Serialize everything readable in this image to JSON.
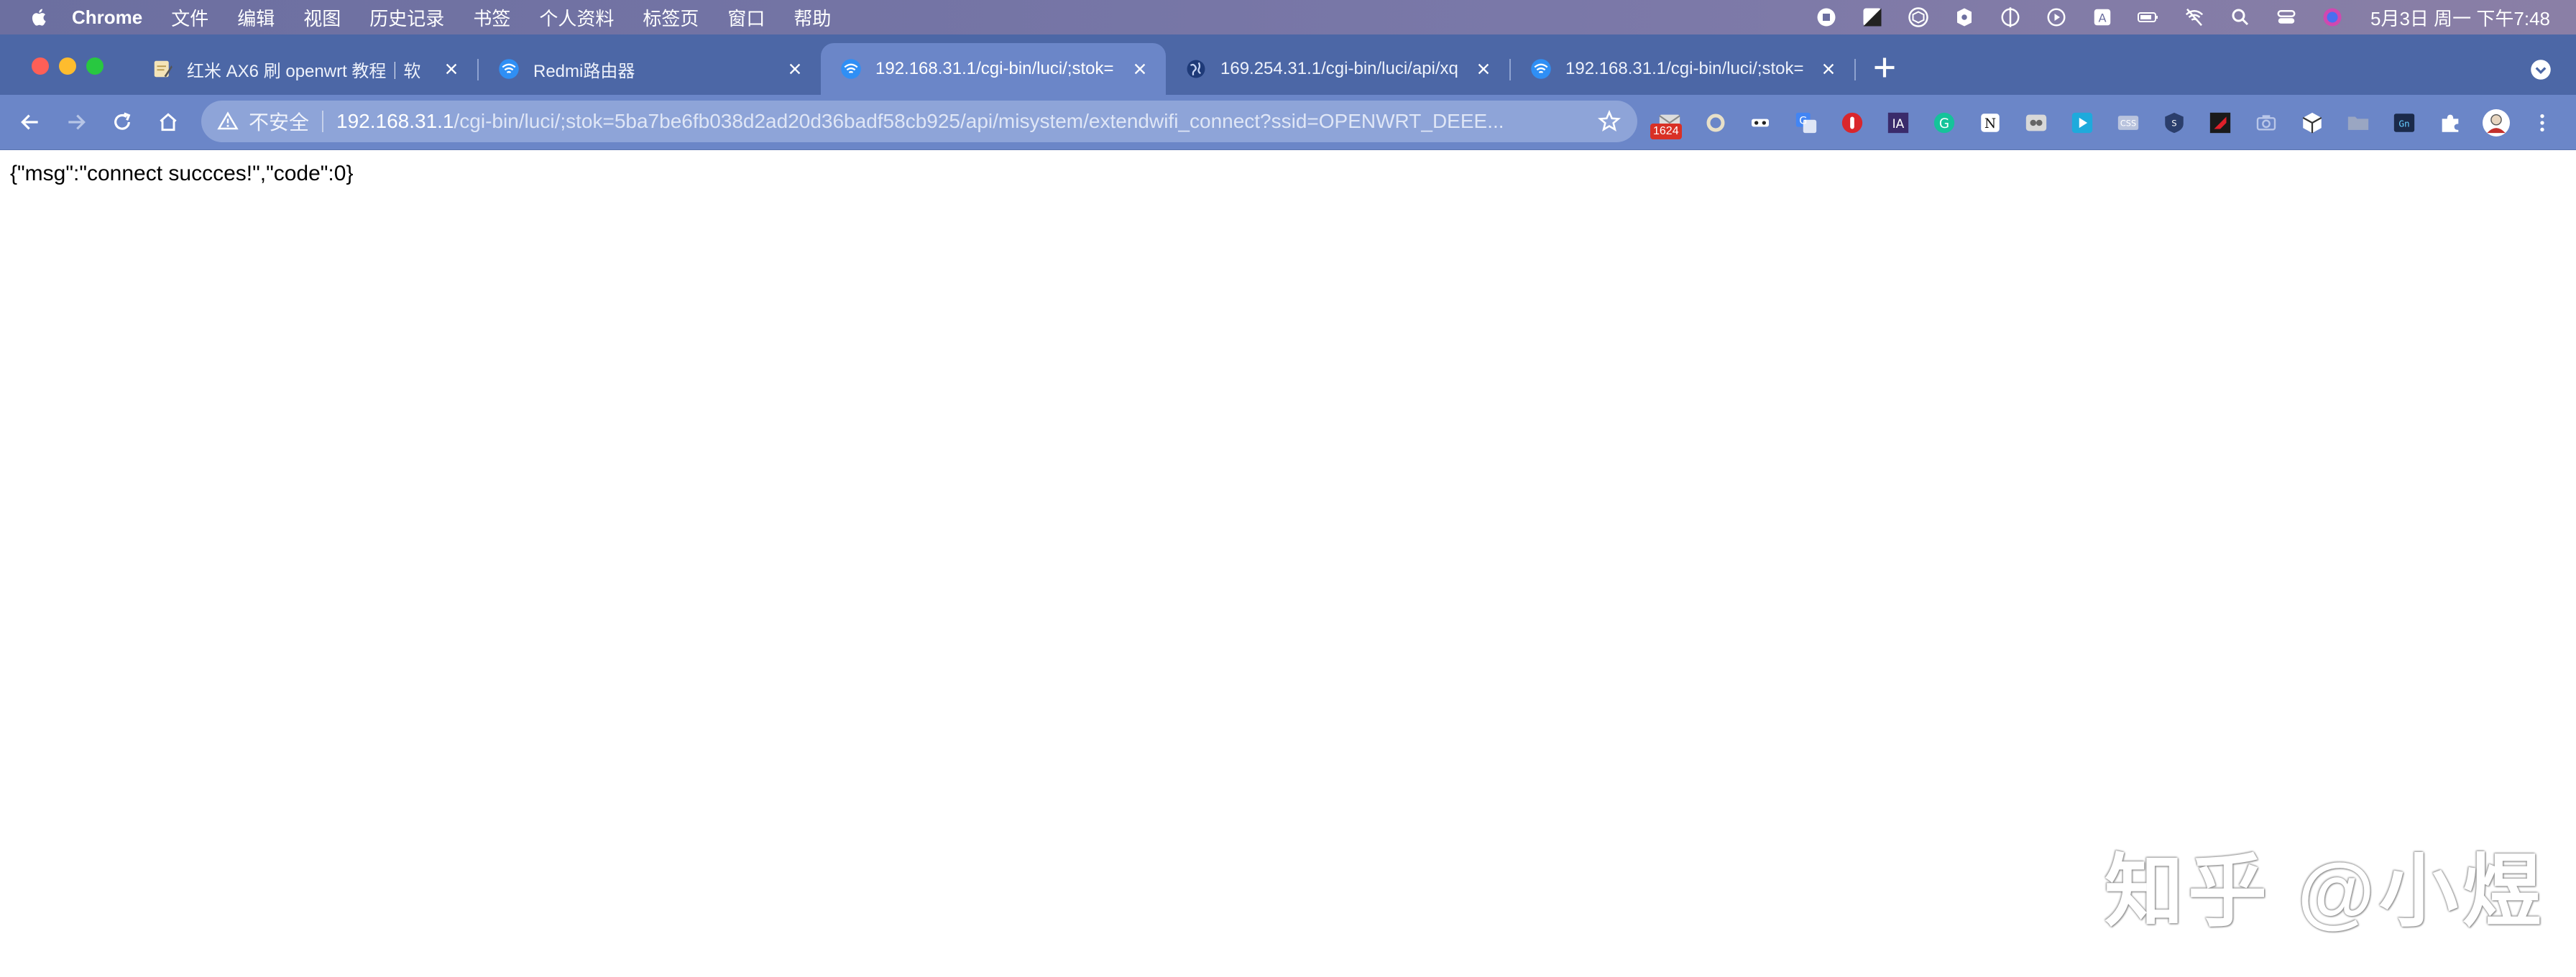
{
  "menubar": {
    "app_name": "Chrome",
    "items": [
      "文件",
      "编辑",
      "视图",
      "历史记录",
      "书签",
      "个人资料",
      "标签页",
      "窗口",
      "帮助"
    ],
    "clock": "5月3日 周一 下午7:48"
  },
  "tabs": [
    {
      "title": "红米 AX6 刷 openwrt 教程｜软",
      "icon": "notepad-icon"
    },
    {
      "title": "Redmi路由器",
      "icon": "wifi-icon"
    },
    {
      "title": "192.168.31.1/cgi-bin/luci/;stok=",
      "icon": "wifi-icon",
      "active": true
    },
    {
      "title": "169.254.31.1/cgi-bin/luci/api/xq",
      "icon": "globe-icon"
    },
    {
      "title": "192.168.31.1/cgi-bin/luci/;stok=",
      "icon": "wifi-icon"
    }
  ],
  "address_bar": {
    "security_label": "不安全",
    "url_host": "192.168.31.1",
    "url_path": "/cgi-bin/luci/;stok=5ba7be6fb038d2ad20d36badf58cb925/api/misystem/extendwifi_connect?ssid=OPENWRT_DEEE..."
  },
  "extension_badge": "1624",
  "page": {
    "response_text": "{\"msg\":\"connect succces!\",\"code\":0}"
  },
  "watermark": "知乎 @小煜"
}
